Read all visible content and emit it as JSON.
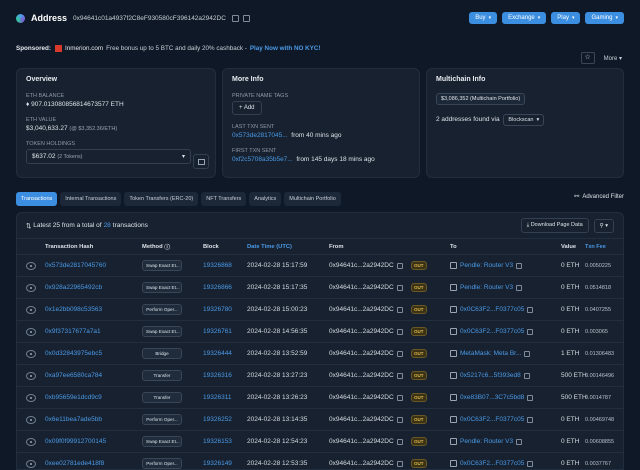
{
  "header": {
    "title": "Address",
    "address": "0x94641c01a4937f2C8eF930580cF396142a2942DC",
    "buttons": [
      "Buy",
      "Exchange",
      "Play",
      "Gaming"
    ]
  },
  "sponsored": {
    "label": "Sponsored:",
    "brand": "Inmerion.com",
    "text": "Free bonus up to 5 BTC and daily 20% cashback -",
    "link": "Play Now with NO KYC!"
  },
  "tools": {
    "star": "☆",
    "more": "More"
  },
  "overview": {
    "title": "Overview",
    "eth_balance_label": "ETH BALANCE",
    "eth_balance": "907.013080856814673577 ETH",
    "eth_value_label": "ETH VALUE",
    "eth_value": "$3,040,633.27",
    "eth_value_rate": "(@ $3,352.36/ETH)",
    "token_label": "TOKEN HOLDINGS",
    "token_value": "$637.02",
    "token_count": "(2 Tokens)"
  },
  "more_info": {
    "title": "More Info",
    "tags_label": "PRIVATE NAME TAGS",
    "add_label": "+ Add",
    "last_label": "LAST TXN SENT",
    "last_hash": "0x573de2817045...",
    "last_age": "from 40 mins ago",
    "first_label": "FIRST TXN SENT",
    "first_hash": "0xf2c5708a35b5e7...",
    "first_age": "from 145 days 18 mins ago"
  },
  "multichain": {
    "title": "Multichain Info",
    "portfolio": "$3,086,352 (Multichain Portfolio)",
    "found_text": "2 addresses found via",
    "via": "Blockscan"
  },
  "tabs": [
    "Transactions",
    "Internal Transactions",
    "Token Transfers (ERC-20)",
    "NFT Transfers",
    "Analytics",
    "Multichain Portfolio"
  ],
  "filter_label": "Advanced Filter",
  "summary": {
    "prefix": "Latest 25 from a total of",
    "count": "28",
    "suffix": "transactions",
    "download": "Download Page Data"
  },
  "columns": [
    "Transaction Hash",
    "Method",
    "Block",
    "Date Time (UTC)",
    "From",
    "To",
    "Value",
    "Txn Fee"
  ],
  "colors": {
    "accent": "#3c8ee0",
    "link": "#4b9ae8",
    "out_badge": "#e0b84a",
    "bg": "#0f1826"
  },
  "rows": [
    {
      "hash": "0x573de2817045760",
      "method": "Swap Exact Et...",
      "block": "19326868",
      "time": "2024-02-28 15:17:59",
      "from": "0x94641c...2a2942DC",
      "dir": "OUT",
      "to": "Pendle: Router V3",
      "value": "0 ETH",
      "fee": "0.0050225"
    },
    {
      "hash": "0x928a22965492cb",
      "method": "Swap Exact Et...",
      "block": "19326866",
      "time": "2024-02-28 15:17:35",
      "from": "0x94641c...2a2942DC",
      "dir": "OUT",
      "to": "Pendle: Router V3",
      "value": "0 ETH",
      "fee": "0.0514818"
    },
    {
      "hash": "0x1e2bb098c53563",
      "method": "Perform Oper...",
      "block": "19326780",
      "time": "2024-02-28 15:00:23",
      "from": "0x94641c...2a2942DC",
      "dir": "OUT",
      "to": "0x0C63F2...F0377c05",
      "value": "0 ETH",
      "fee": "0.0407255"
    },
    {
      "hash": "0x9f37317677a7a1",
      "method": "Swap Exact Et...",
      "block": "19326761",
      "time": "2024-02-28 14:56:35",
      "from": "0x94641c...2a2942DC",
      "dir": "OUT",
      "to": "0x0C63F2...F0377c05",
      "value": "0 ETH",
      "fee": "0.003065"
    },
    {
      "hash": "0x0d32843975ebc5",
      "method": "Bridge",
      "block": "19326444",
      "time": "2024-02-28 13:52:59",
      "from": "0x94641c...2a2942DC",
      "dir": "OUT",
      "to": "MetaMask: Meta Br...",
      "value": "1 ETH",
      "fee": "0.01306483"
    },
    {
      "hash": "0xa97ee6580ca784",
      "method": "Transfer",
      "block": "19326316",
      "time": "2024-02-28 13:27:23",
      "from": "0x94641c...2a2942DC",
      "dir": "OUT",
      "to": "0x5217c6...5f393ed8",
      "value": "500 ETH",
      "fee": "0.00146496"
    },
    {
      "hash": "0xb95659e1dcd9c9",
      "method": "Transfer",
      "block": "19326311",
      "time": "2024-02-28 13:26:23",
      "from": "0x94641c...2a2942DC",
      "dir": "OUT",
      "to": "0xe83B07...3C7c5bd8",
      "value": "500 ETH",
      "fee": "0.0014787"
    },
    {
      "hash": "0x6e11bea7ade5bb",
      "method": "Perform Oper...",
      "block": "19326252",
      "time": "2024-02-28 13:14:35",
      "from": "0x94641c...2a2942DC",
      "dir": "OUT",
      "to": "0x0C63F2...F0377c05",
      "value": "0 ETH",
      "fee": "0.00469748"
    },
    {
      "hash": "0x09f0f99912700145",
      "method": "Swap Exact Et...",
      "block": "19326153",
      "time": "2024-02-28 12:54:23",
      "from": "0x94641c...2a2942DC",
      "dir": "OUT",
      "to": "Pendle: Router V3",
      "value": "0 ETH",
      "fee": "0.00608855"
    },
    {
      "hash": "0xee02781ede418f8",
      "method": "Perform Oper...",
      "block": "19326149",
      "time": "2024-02-28 12:53:35",
      "from": "0x94641c...2a2942DC",
      "dir": "OUT",
      "to": "0x0C63F2...F0377c05",
      "value": "0 ETH",
      "fee": "0.0037767"
    }
  ]
}
